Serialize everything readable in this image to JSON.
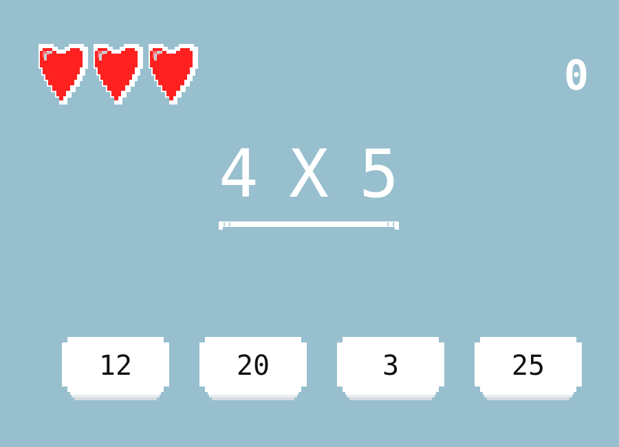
{
  "game": {
    "lives": 3,
    "score": "0",
    "problem": {
      "left": "4",
      "operator": "X",
      "right": "5"
    },
    "answers": [
      {
        "label": "12"
      },
      {
        "label": "20"
      },
      {
        "label": "3"
      },
      {
        "label": "25"
      }
    ]
  },
  "icons": {
    "life": "heart-icon"
  },
  "colors": {
    "background": "#98bfce",
    "heart": "#ff2020",
    "button": "#ffffff",
    "text": "#ffffff",
    "answer_text": "#111111"
  }
}
